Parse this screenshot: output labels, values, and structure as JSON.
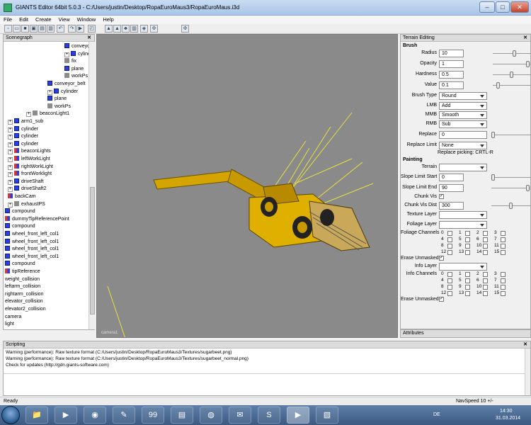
{
  "window": {
    "title": "GIANTS Editor 64bit 5.0.3 - C:/Users/justin/Desktop/RopaEuroMaus3/RopaEuroMaus.i3d",
    "minimize": "–",
    "maximize": "□",
    "close": "✕"
  },
  "menu": [
    "File",
    "Edit",
    "Create",
    "View",
    "Window",
    "Help"
  ],
  "toolbar_icons": [
    "new-icon",
    "open-icon",
    "save-icon",
    "save-as-icon",
    "import-icon",
    "export-icon",
    "undo-icon",
    "redo-icon",
    "play-icon",
    "select-mode-icon",
    "terrain-sculpt-icon",
    "terrain-paint-icon",
    "foliage-icon",
    "texture-paint-icon",
    "info-layer-icon",
    "snap-icon",
    "settings-icon"
  ],
  "scenegraph": {
    "title": "Scenegraph",
    "close": "✕",
    "nodes": [
      {
        "label": "conveyo",
        "icon": "blue",
        "indent": 84,
        "exp": false
      },
      {
        "label": "cylinder",
        "icon": "blue",
        "indent": 84,
        "exp": true
      },
      {
        "label": "fix",
        "icon": "grey",
        "indent": 84,
        "exp": false
      },
      {
        "label": "plane",
        "icon": "blue",
        "indent": 84,
        "exp": false
      },
      {
        "label": "workPs",
        "icon": "grey",
        "indent": 84,
        "exp": false
      },
      {
        "label": "conveyor_belt",
        "icon": "blue",
        "indent": 60,
        "exp": false
      },
      {
        "label": "cylinder",
        "icon": "blue",
        "indent": 60,
        "exp": true
      },
      {
        "label": "plane",
        "icon": "blue",
        "indent": 60,
        "exp": false
      },
      {
        "label": "workPs",
        "icon": "grey",
        "indent": 60,
        "exp": false
      },
      {
        "label": "beaconLight1",
        "icon": "grey",
        "indent": 30,
        "exp": true
      },
      {
        "label": "arm1_sub",
        "icon": "blue",
        "indent": 4,
        "exp": true
      },
      {
        "label": "cylinder",
        "icon": "blue",
        "indent": 4,
        "exp": true
      },
      {
        "label": "cylinder",
        "icon": "blue",
        "indent": 4,
        "exp": true
      },
      {
        "label": "cylinder",
        "icon": "blue",
        "indent": 4,
        "exp": true
      },
      {
        "label": "beaconLights",
        "icon": "mixed",
        "indent": 4,
        "exp": true
      },
      {
        "label": "leftWorkLight",
        "icon": "mixed",
        "indent": 4,
        "exp": true
      },
      {
        "label": "rightWorkLight",
        "icon": "mixed",
        "indent": 4,
        "exp": true
      },
      {
        "label": "frontWorklight",
        "icon": "mixed",
        "indent": 4,
        "exp": true
      },
      {
        "label": "driveShaft",
        "icon": "blue",
        "indent": 4,
        "exp": true
      },
      {
        "label": "driveShaft2",
        "icon": "blue",
        "indent": 4,
        "exp": true
      },
      {
        "label": "backCam",
        "icon": "mixed",
        "indent": 4,
        "exp": false
      },
      {
        "label": "exhaustPS",
        "icon": "grey",
        "indent": 4,
        "exp": true
      },
      {
        "label": "compound",
        "icon": "blue",
        "indent": 0,
        "exp": false
      },
      {
        "label": "dummyTipReferencePoint",
        "icon": "mixed",
        "indent": 0,
        "exp": false
      },
      {
        "label": "compound",
        "icon": "blue",
        "indent": 0,
        "exp": false
      },
      {
        "label": "wheel_front_left_col1",
        "icon": "blue",
        "indent": 0,
        "exp": false
      },
      {
        "label": "wheel_front_left_col1",
        "icon": "blue",
        "indent": 0,
        "exp": false
      },
      {
        "label": "wheel_front_left_col1",
        "icon": "blue",
        "indent": 0,
        "exp": false
      },
      {
        "label": "wheel_front_left_col1",
        "icon": "blue",
        "indent": 0,
        "exp": false
      },
      {
        "label": "compound",
        "icon": "blue",
        "indent": 0,
        "exp": false
      },
      {
        "label": "tipReference",
        "icon": "mixed",
        "indent": 0,
        "exp": false
      },
      {
        "label": "weight_collision",
        "icon": "none",
        "indent": 0,
        "exp": false
      },
      {
        "label": "leftarm_collision",
        "icon": "none",
        "indent": 0,
        "exp": false
      },
      {
        "label": "rightarm_collision",
        "icon": "none",
        "indent": 0,
        "exp": false
      },
      {
        "label": "elevator_collision",
        "icon": "none",
        "indent": 0,
        "exp": false
      },
      {
        "label": "elevator2_collision",
        "icon": "none",
        "indent": 0,
        "exp": false
      },
      {
        "label": "camera",
        "icon": "none",
        "indent": 0,
        "exp": false
      },
      {
        "label": "light",
        "icon": "none",
        "indent": 0,
        "exp": false
      }
    ]
  },
  "viewport": {
    "camera_label": "camera1"
  },
  "terrain": {
    "title": "Terrain Editing",
    "close": "✕",
    "brush_header": "Brush",
    "radius_label": "Radius",
    "radius_value": "10",
    "radius_level": 0.6,
    "opacity_label": "Opacity",
    "opacity_value": "1",
    "opacity_level": 1.0,
    "hardness_label": "Hardness",
    "hardness_value": "0.5",
    "hardness_level": 0.5,
    "value_label": "Value",
    "value_value": "0.1",
    "value_level": 0.1,
    "brushtype_label": "Brush Type",
    "brushtype_value": "Round",
    "lmb_label": "LMB",
    "lmb_value": "Add",
    "mmb_label": "MMB",
    "mmb_value": "Smooth",
    "rmb_label": "RMB",
    "rmb_value": "Sub",
    "replace_label": "Replace",
    "replace_value": "0",
    "replace_level": 0.0,
    "replacelimit_label": "Replace Limit",
    "replacelimit_value": "None",
    "replace_picking": "Replace picking: CRTL-R",
    "painting_header": "Painting",
    "terrain_label": "Terrain",
    "terrain_value": "",
    "slopestart_label": "Slope Limit Start",
    "slopestart_value": "0",
    "slopestart_level": 0.0,
    "slopeend_label": "Slope Limit End",
    "slopeend_value": "90",
    "slopeend_level": 1.0,
    "chunkvis_label": "Chunk Vis",
    "chunkvis_checked": "✓",
    "chunkvisdist_label": "Chunk Vis Dist",
    "chunkvisdist_value": "300",
    "chunkvisdist_level": 0.5,
    "texturelayer_label": "Texture Layer",
    "texturelayer_value": "",
    "foliagelayer_label": "Foliage Layer",
    "foliagelayer_value": "",
    "foliagechannels_label": "Foliage Channels",
    "channels": [
      "0",
      "1",
      "2",
      "3",
      "4",
      "5",
      "6",
      "7",
      "8",
      "9",
      "10",
      "11",
      "12",
      "13",
      "14",
      "15"
    ],
    "eraseunmasked_label": "Erase Unmasked",
    "eraseunmasked_checked": "✓",
    "infolayer_label": "Info Layer",
    "infolayer_value": "",
    "infochannels_label": "Info Channels",
    "eraseunmasked2_label": "Erase Unmasked",
    "eraseunmasked2_checked": "✓"
  },
  "attributes": {
    "title": "Attributes"
  },
  "scripting": {
    "title": "Scripting",
    "close": "✕",
    "lines": [
      "Warning (performance): Raw texture format (C:/Users/justin/Desktop/RopaEuroMaus3/Textures/sugarbeet.png)",
      "Warning (performance): Raw texture format (C:/Users/justin/Desktop/RopaEuroMaus3/Textures/sugarbeet_normal.png)",
      "Check for updates (http://gdn.giants-software.com)"
    ]
  },
  "status": {
    "left": "Ready",
    "right": "NavSpeed 10 +/-"
  },
  "taskbar": {
    "apps": [
      "explorer-icon",
      "media-player-icon",
      "chrome-icon",
      "gimp-icon",
      "game-icon",
      "file-manager-icon",
      "firefox-icon",
      "paint-icon",
      "skype-icon",
      "giants-editor-icon",
      "picture-icon"
    ],
    "lang": "DE",
    "time": "14:30",
    "date": "31.03.2014"
  }
}
